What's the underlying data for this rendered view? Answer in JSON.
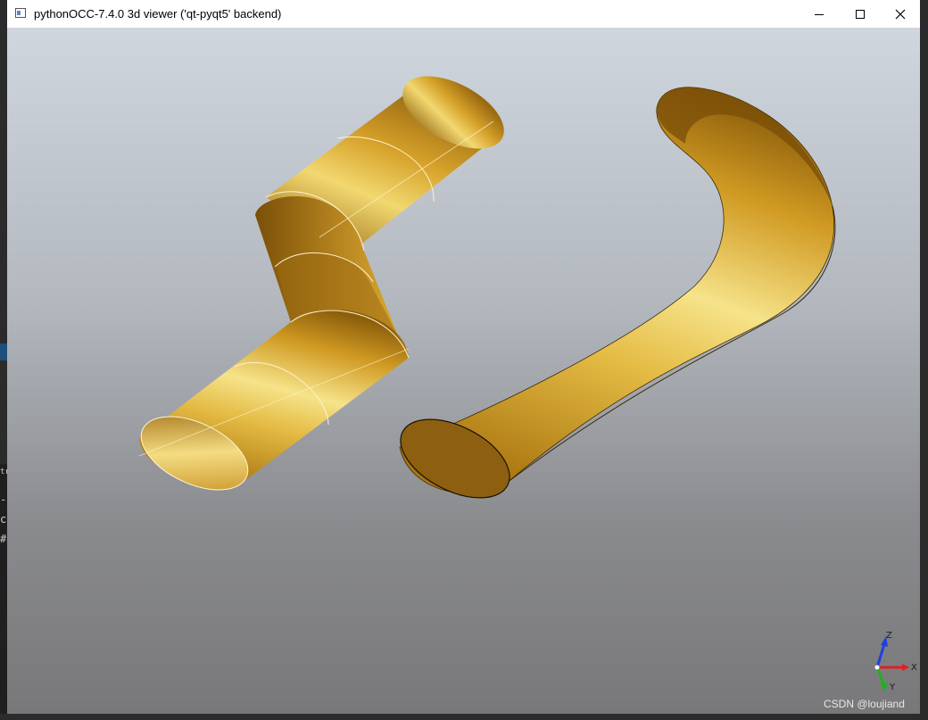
{
  "window": {
    "title": "pythonOCC-7.4.0 3d viewer ('qt-pyqt5' backend)",
    "buttons": [
      "minimize-icon",
      "maximize-icon",
      "close-icon"
    ]
  },
  "viewport": {
    "background_top": "#d0d6de",
    "background_bottom": "#78787a",
    "shape_color": "#c8961e",
    "shapes": [
      "segmented-pipe",
      "smooth-bent-pipe"
    ]
  },
  "triad": {
    "x_label": "X",
    "y_label": "Y",
    "z_label": "Z",
    "colors": {
      "x": "#e02020",
      "y": "#20b020",
      "z": "#2040e0"
    }
  },
  "watermark": "CSDN @loujiand",
  "background_app": {
    "fragments": [
      "tr",
      "-[",
      "c",
      "#"
    ]
  }
}
